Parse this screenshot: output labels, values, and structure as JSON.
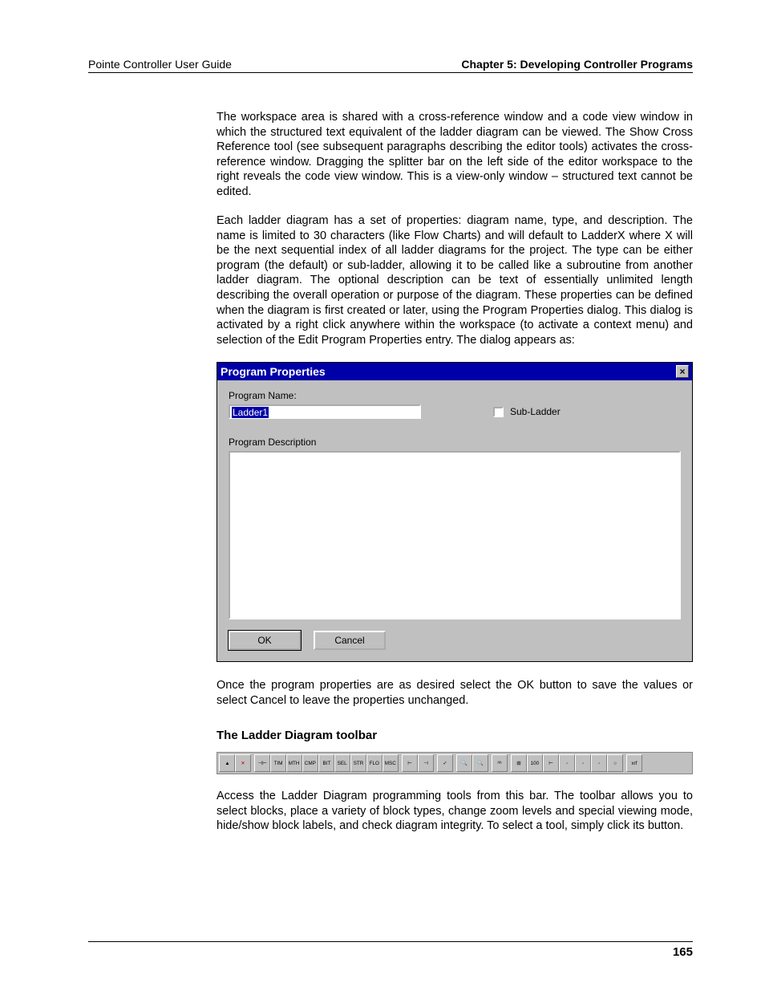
{
  "header": {
    "left": "Pointe Controller User Guide",
    "right": "Chapter 5: Developing Controller Programs"
  },
  "paragraphs": {
    "p1": "The workspace area is shared with a cross-reference window and a code view window in which the structured text equivalent of the ladder diagram can be viewed. The Show Cross Reference tool (see subsequent paragraphs describing the editor tools) activates the cross-reference window. Dragging the splitter bar on the left side of the editor workspace to the right reveals the code view window. This is a view-only window – structured text cannot be edited.",
    "p2": "Each ladder diagram has a set of properties: diagram name, type, and description. The name is limited to 30 characters (like Flow Charts) and will default to LadderX where X will be the next sequential index of all ladder diagrams for the project. The type can be either program (the default) or sub-ladder, allowing it to be called like a subroutine from another ladder diagram. The optional description can be text of essentially unlimited length describing the overall operation or purpose of the diagram. These properties can be defined when the diagram is first created or later, using the Program Properties dialog. This dialog is activated by a right click anywhere within the workspace (to activate a context menu) and selection of the Edit Program Properties entry. The dialog appears as:",
    "p3": "Once the program properties are as desired select the OK button to save the values or select Cancel to leave the properties unchanged.",
    "p4": "Access the Ladder Diagram programming tools from this bar. The toolbar allows you to select blocks, place a variety of block types, change zoom levels and special viewing mode, hide/show block labels, and check diagram integrity. To select a tool, simply click its button."
  },
  "section_title": "The Ladder Diagram toolbar",
  "dialog": {
    "title": "Program Properties",
    "close_glyph": "×",
    "name_label": "Program Name:",
    "name_value": "Ladder1",
    "subladder_label": "Sub-Ladder",
    "desc_label": "Program Description",
    "ok_label": "OK",
    "cancel_label": "Cancel"
  },
  "toolbar": {
    "buttons": [
      {
        "name": "pointer-tool-icon",
        "glyph": "▲"
      },
      {
        "name": "delete-tool-icon",
        "glyph": "✕",
        "color": "#c00"
      },
      {
        "name": "sep"
      },
      {
        "name": "contact-block-icon",
        "glyph": "⊣⊢"
      },
      {
        "name": "tim-block-icon",
        "glyph": "TIM"
      },
      {
        "name": "mth-block-icon",
        "glyph": "MTH"
      },
      {
        "name": "cmp-block-icon",
        "glyph": "CMP"
      },
      {
        "name": "bit-block-icon",
        "glyph": "BIT"
      },
      {
        "name": "sel-block-icon",
        "glyph": "SEL"
      },
      {
        "name": "str-block-icon",
        "glyph": "STR"
      },
      {
        "name": "flo-block-icon",
        "glyph": "FLO"
      },
      {
        "name": "msc-block-icon",
        "glyph": "MSC"
      },
      {
        "name": "sep"
      },
      {
        "name": "coil-block-icon",
        "glyph": "⊢"
      },
      {
        "name": "coil2-block-icon",
        "glyph": "⊣"
      },
      {
        "name": "sep"
      },
      {
        "name": "check-tool-icon",
        "glyph": "✓"
      },
      {
        "name": "sep"
      },
      {
        "name": "zoom-in-icon",
        "glyph": "🔍"
      },
      {
        "name": "zoom-out-icon",
        "glyph": "🔍"
      },
      {
        "name": "sep"
      },
      {
        "name": "labels-tool-icon",
        "glyph": "ᴬᵇ"
      },
      {
        "name": "sep"
      },
      {
        "name": "grid-tool-icon",
        "glyph": "⊞"
      },
      {
        "name": "zoom100-tool-icon",
        "glyph": "100"
      },
      {
        "name": "hline-tool-icon",
        "glyph": "⊢"
      },
      {
        "name": "tool-a-icon",
        "glyph": "◦"
      },
      {
        "name": "tool-b-icon",
        "glyph": "◦"
      },
      {
        "name": "tool-c-icon",
        "glyph": "◦"
      },
      {
        "name": "tool-d-icon",
        "glyph": "○"
      },
      {
        "name": "sep"
      },
      {
        "name": "xref-tool-icon",
        "glyph": "xrf"
      }
    ]
  },
  "page_number": "165"
}
